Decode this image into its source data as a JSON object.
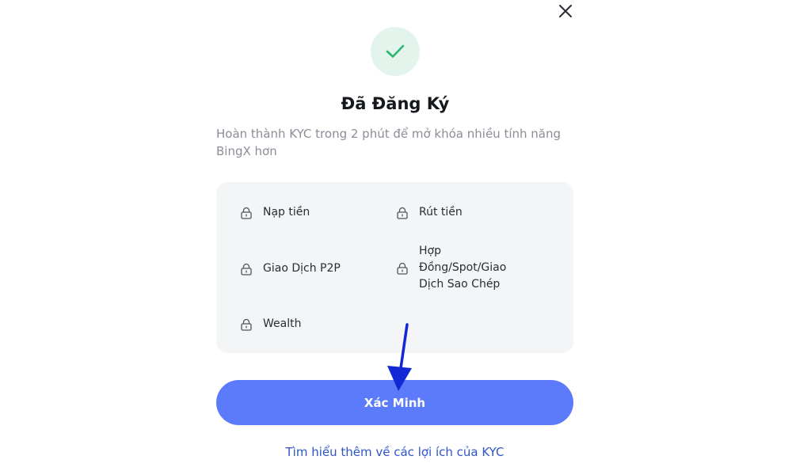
{
  "dialog": {
    "title": "Đã Đăng Ký",
    "subtitle": "Hoàn thành KYC trong 2 phút để mở khóa nhiều tính năng BingX hơn",
    "success_icon": "check-icon",
    "close_icon": "close-icon",
    "features": [
      {
        "label": "Nạp tiền",
        "icon": "lock-icon"
      },
      {
        "label": "Rút tiền",
        "icon": "lock-icon"
      },
      {
        "label": "Giao Dịch P2P",
        "icon": "lock-icon"
      },
      {
        "label": "Hợp Đồng/Spot/Giao Dịch Sao Chép",
        "icon": "lock-icon"
      },
      {
        "label": "Wealth",
        "icon": "lock-icon"
      }
    ],
    "verify_button": "Xác Minh",
    "learn_more_link": "Tìm hiểu thêm về các lợi ích của KYC"
  },
  "colors": {
    "accent": "#5b7bfa",
    "success": "#2bb673",
    "success_bg": "#e3f4ec",
    "link": "#2d55c8",
    "card_bg": "#f4f5f7",
    "annotation_arrow": "#1227d6"
  }
}
